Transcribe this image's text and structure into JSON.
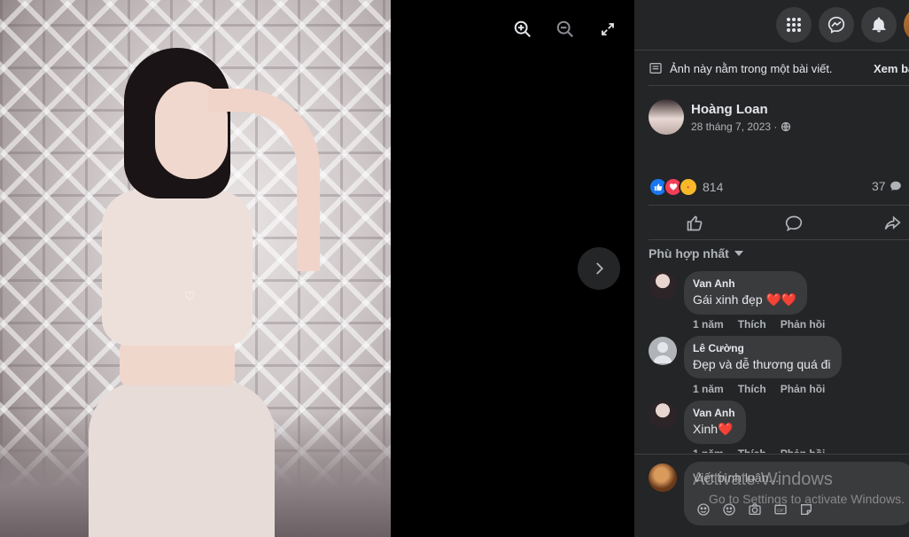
{
  "viewer": {
    "zoom_in_icon": "zoom-in-icon",
    "zoom_out_icon": "zoom-out-icon",
    "fullscreen_icon": "fullscreen-icon",
    "next_icon": "chevron-right-icon"
  },
  "topbar": {
    "menu_icon": "grid-menu-icon",
    "messenger_icon": "messenger-icon",
    "notifications_icon": "bell-icon"
  },
  "notice": {
    "text": "Ảnh này nằm trong một bài viết.",
    "link": "Xem bài viết"
  },
  "post": {
    "author": "Hoàng Loan",
    "date": "28 tháng 7, 2023 ·",
    "privacy_icon": "globe-icon",
    "reaction_count": "814",
    "comment_count": "37",
    "reactions": [
      "like",
      "love",
      "care"
    ]
  },
  "actions": {
    "like_icon": "like-icon",
    "comment_icon": "comment-icon",
    "share_icon": "share-icon"
  },
  "sort": {
    "label": "Phù hợp nhất"
  },
  "comments": [
    {
      "name": "Van Anh",
      "text": "Gái xinh đẹp ❤️❤️",
      "time": "1 năm",
      "like": "Thích",
      "reply": "Phản hồi"
    },
    {
      "name": "Lê Cường",
      "text": "Đẹp và dễ thương quá đi",
      "time": "1 năm",
      "like": "Thích",
      "reply": "Phản hồi"
    },
    {
      "name": "Van Anh",
      "text": "Xinh❤️",
      "time": "1 năm",
      "like": "Thích",
      "reply": "Phản hồi"
    }
  ],
  "composer": {
    "placeholder": "Viết bình luận..."
  },
  "watermark": {
    "line1": "Activate Windows",
    "line2": "Go to Settings to activate Windows."
  },
  "colors": {
    "panel_bg": "#242526",
    "bubble_bg": "#3a3b3c",
    "text_primary": "#e4e6eb",
    "text_secondary": "#b0b3b8",
    "like_blue": "#1877f2",
    "love_red": "#f33e58"
  }
}
